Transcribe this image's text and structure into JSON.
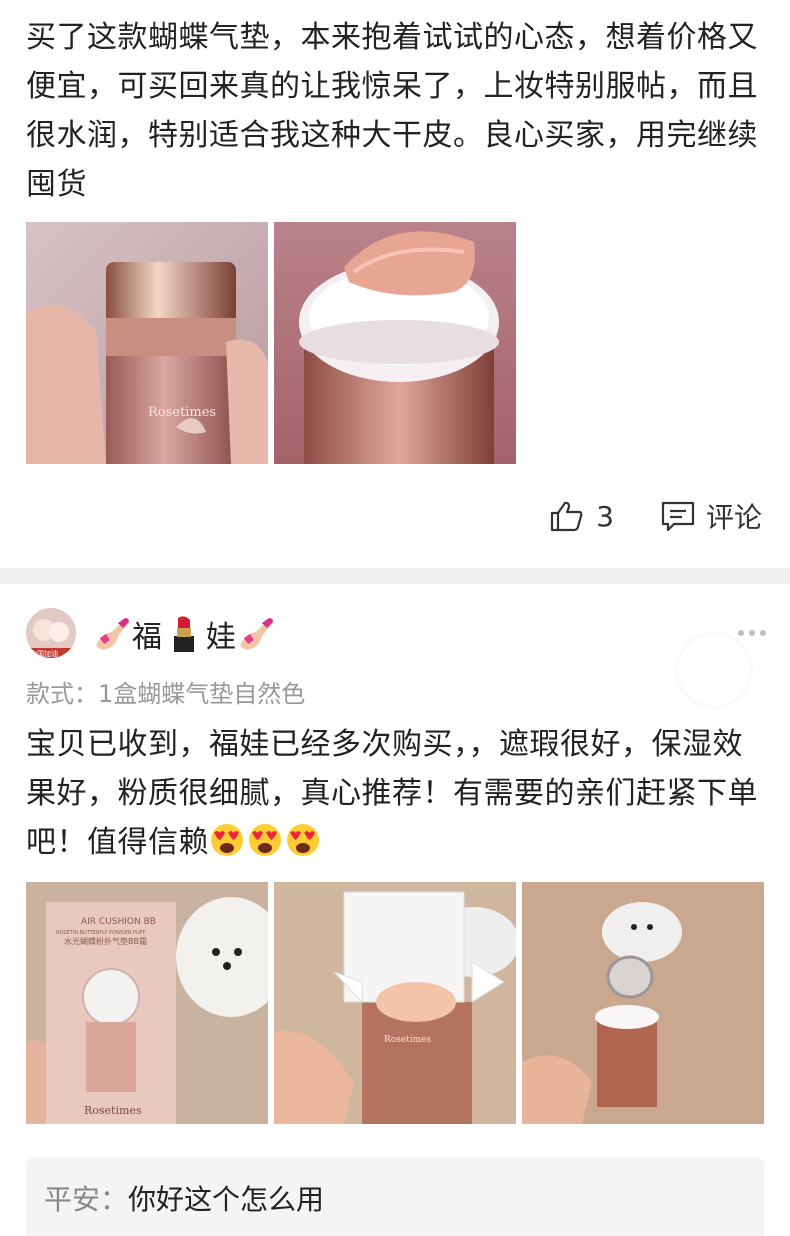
{
  "review1": {
    "text": "买了这款蝴蝶气垫，本来抱着试试的心态，想着价格又便宜，可买回来真的让我惊呆了，上妆特别服帖，而且很水润，特别适合我这种大干皮。良心买家，用完继续囤货",
    "photos": [
      {
        "icon": "cushion-bottle-photo",
        "brand": "Rosetimes"
      },
      {
        "icon": "open-cushion-photo"
      }
    ],
    "likes": "3",
    "comment_label": "评论"
  },
  "review2": {
    "username": "福娃",
    "variant": "款式：1盒蝴蝶气垫自然色",
    "text": "宝贝已收到，福娃已经多次购买，，遮瑕很好，保湿效果好，粉质很细腻，真心推荐！有需要的亲们赶紧下单吧！值得信赖",
    "photos": [
      {
        "icon": "product-box-photo",
        "box_title": "AIR CUSHION BB",
        "box_subtitle": "ROSETIN BUTTERFLY POWDER PUFF",
        "box_cn": "水光蝴蝶粉扑气垫BB霜",
        "brand": "Rosetimes"
      },
      {
        "icon": "opened-box-photo",
        "brand": "Rosetimes"
      },
      {
        "icon": "cushion-in-hand-photo"
      }
    ],
    "reply": {
      "who": "平安：",
      "message": "你好这个怎么用"
    }
  },
  "colors": {
    "text": "#222222",
    "muted": "#999999",
    "separator": "#efefef",
    "reply_bg": "#f4f4f4"
  }
}
